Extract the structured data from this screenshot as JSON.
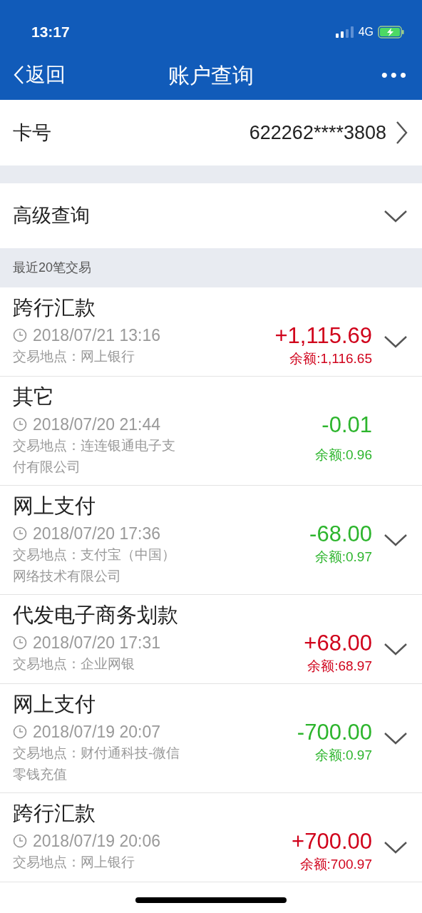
{
  "status_bar": {
    "time": "13:17",
    "network": "4G"
  },
  "nav": {
    "back": "返回",
    "title": "账户查询",
    "more": "•••"
  },
  "card": {
    "label": "卡号",
    "number": "622262****3808"
  },
  "advanced": {
    "label": "高级查询",
    "expanded": false
  },
  "section": {
    "title": "最近20笔交易"
  },
  "transactions": [
    {
      "type": "跨行汇款",
      "time": "2018/07/21 13:16",
      "location": "交易地点：网上银行",
      "amount": "+1,115.69",
      "balance": "余额:1,116.65",
      "kind": "credit",
      "expandable": true
    },
    {
      "type": "其它",
      "time": "2018/07/20 21:44",
      "location": "交易地点：连连银通电子支付有限公司",
      "amount": "-0.01",
      "balance": "余额:0.96",
      "kind": "debit",
      "expandable": false
    },
    {
      "type": "网上支付",
      "time": "2018/07/20 17:36",
      "location": "交易地点：支付宝（中国）网络技术有限公司",
      "amount": "-68.00",
      "balance": "余额:0.97",
      "kind": "debit",
      "expandable": true
    },
    {
      "type": "代发电子商务划款",
      "time": "2018/07/20 17:31",
      "location": "交易地点：企业网银",
      "amount": "+68.00",
      "balance": "余额:68.97",
      "kind": "credit",
      "expandable": true
    },
    {
      "type": "网上支付",
      "time": "2018/07/19 20:07",
      "location": "交易地点：财付通科技-微信零钱充值",
      "amount": "-700.00",
      "balance": "余额:0.97",
      "kind": "debit",
      "expandable": true
    },
    {
      "type": "跨行汇款",
      "time": "2018/07/19 20:06",
      "location": "交易地点：网上银行",
      "amount": "+700.00",
      "balance": "余额:700.97",
      "kind": "credit",
      "expandable": true
    }
  ]
}
